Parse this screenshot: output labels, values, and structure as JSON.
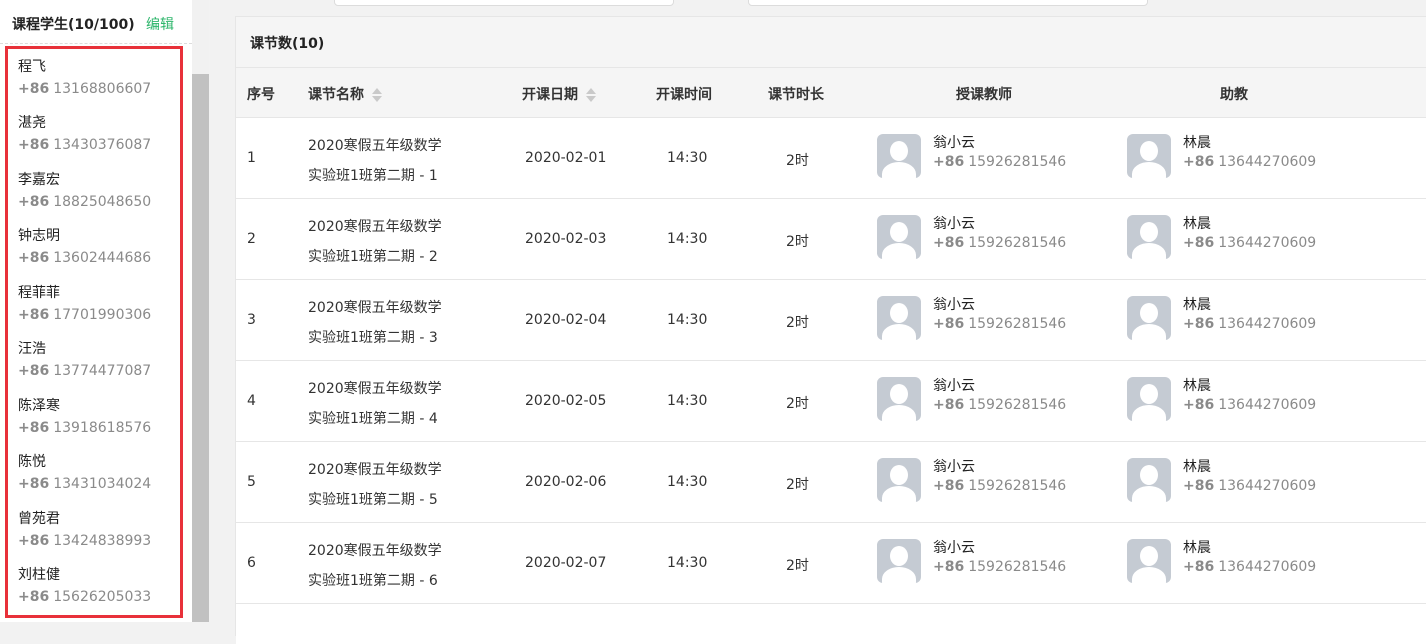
{
  "students_panel": {
    "title": "课程学生(10/100)",
    "edit_label": "编辑",
    "country_code": "+86",
    "students": [
      {
        "name": "程飞",
        "phone": "13168806607"
      },
      {
        "name": "湛尧",
        "phone": "13430376087"
      },
      {
        "name": "李嘉宏",
        "phone": "18825048650"
      },
      {
        "name": "钟志明",
        "phone": "13602444686"
      },
      {
        "name": "程菲菲",
        "phone": "17701990306"
      },
      {
        "name": "汪浩",
        "phone": "13774477087"
      },
      {
        "name": "陈泽寒",
        "phone": "13918618576"
      },
      {
        "name": "陈悦",
        "phone": "13431034024"
      },
      {
        "name": "曾苑君",
        "phone": "13424838993"
      },
      {
        "name": "刘柱健",
        "phone": "15626205033"
      }
    ]
  },
  "lessons": {
    "title": "课节数(10)",
    "columns": {
      "index": "序号",
      "name": "课节名称",
      "date": "开课日期",
      "time": "开课时间",
      "duration": "课节时长",
      "teacher": "授课教师",
      "assistant": "助教"
    },
    "rows": [
      {
        "index": "1",
        "name_line1": "2020寒假五年级数学",
        "name_line2": "实验班1班第二期 - 1",
        "date": "2020-02-01",
        "time": "14:30",
        "duration": "2时",
        "teacher": {
          "name": "翁小云",
          "cc": "+86",
          "phone": "15926281546"
        },
        "assistant": {
          "name": "林晨",
          "cc": "+86",
          "phone": "13644270609"
        }
      },
      {
        "index": "2",
        "name_line1": "2020寒假五年级数学",
        "name_line2": "实验班1班第二期 - 2",
        "date": "2020-02-03",
        "time": "14:30",
        "duration": "2时",
        "teacher": {
          "name": "翁小云",
          "cc": "+86",
          "phone": "15926281546"
        },
        "assistant": {
          "name": "林晨",
          "cc": "+86",
          "phone": "13644270609"
        }
      },
      {
        "index": "3",
        "name_line1": "2020寒假五年级数学",
        "name_line2": "实验班1班第二期 - 3",
        "date": "2020-02-04",
        "time": "14:30",
        "duration": "2时",
        "teacher": {
          "name": "翁小云",
          "cc": "+86",
          "phone": "15926281546"
        },
        "assistant": {
          "name": "林晨",
          "cc": "+86",
          "phone": "13644270609"
        }
      },
      {
        "index": "4",
        "name_line1": "2020寒假五年级数学",
        "name_line2": "实验班1班第二期 - 4",
        "date": "2020-02-05",
        "time": "14:30",
        "duration": "2时",
        "teacher": {
          "name": "翁小云",
          "cc": "+86",
          "phone": "15926281546"
        },
        "assistant": {
          "name": "林晨",
          "cc": "+86",
          "phone": "13644270609"
        }
      },
      {
        "index": "5",
        "name_line1": "2020寒假五年级数学",
        "name_line2": "实验班1班第二期 - 5",
        "date": "2020-02-06",
        "time": "14:30",
        "duration": "2时",
        "teacher": {
          "name": "翁小云",
          "cc": "+86",
          "phone": "15926281546"
        },
        "assistant": {
          "name": "林晨",
          "cc": "+86",
          "phone": "13644270609"
        }
      },
      {
        "index": "6",
        "name_line1": "2020寒假五年级数学",
        "name_line2": "实验班1班第二期 - 6",
        "date": "2020-02-07",
        "time": "14:30",
        "duration": "2时",
        "teacher": {
          "name": "翁小云",
          "cc": "+86",
          "phone": "15926281546"
        },
        "assistant": {
          "name": "林晨",
          "cc": "+86",
          "phone": "13644270609"
        }
      }
    ]
  },
  "colors": {
    "edit_link": "#2bb56a",
    "highlight_border": "#e8313a"
  }
}
